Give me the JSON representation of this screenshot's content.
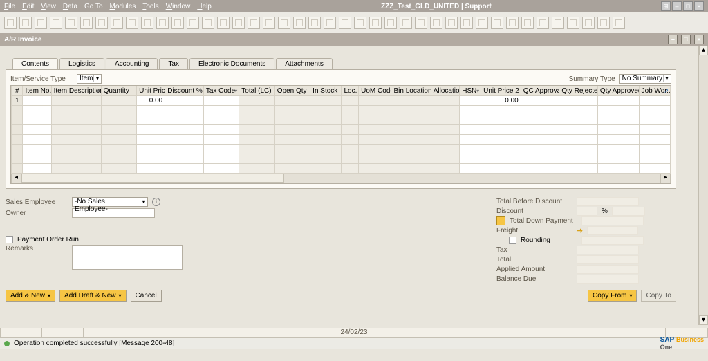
{
  "menubar": {
    "file": "File",
    "edit": "Edit",
    "view": "View",
    "data": "Data",
    "goto": "Go To",
    "modules": "Modules",
    "tools": "Tools",
    "window": "Window",
    "help": "Help"
  },
  "app_title": "ZZZ_Test_GLD_UNITED | Support",
  "window_title": "A/R Invoice",
  "tabs": {
    "contents": "Contents",
    "logistics": "Logistics",
    "accounting": "Accounting",
    "tax": "Tax",
    "edocs": "Electronic Documents",
    "attachments": "Attachments"
  },
  "form": {
    "item_service_label": "Item/Service Type",
    "item_service_value": "Item",
    "summary_type_label": "Summary Type",
    "summary_type_value": "No Summary",
    "columns": {
      "num": "#",
      "itemno": "Item No.",
      "itemdesc": "Item Description",
      "qty": "Quantity",
      "unitprice": "Unit Price",
      "disc": "Discount %",
      "taxcode": "Tax Code",
      "total": "Total (LC)",
      "openqty": "Open Qty",
      "instock": "In Stock",
      "loc": "Loc.",
      "uom": "UoM Code",
      "bin": "Bin Location Allocation",
      "hsn": "HSN",
      "unitprice2": "Unit Price 2",
      "qc": "QC Approval",
      "qtyrej": "Qty Rejected",
      "qtyapp": "Qty Approved",
      "jobwork": "Job Wor..."
    },
    "row1": {
      "idx": "1",
      "unitprice": "0.00",
      "unitprice2": "0.00"
    }
  },
  "lower": {
    "sales_employee_label": "Sales Employee",
    "sales_employee_value": "-No Sales Employee-",
    "owner_label": "Owner",
    "payment_order_run": "Payment Order Run",
    "remarks": "Remarks"
  },
  "totals": {
    "tbd": "Total Before Discount",
    "discount": "Discount",
    "pct": "%",
    "tdp": "Total Down Payment",
    "freight": "Freight",
    "rounding": "Rounding",
    "tax": "Tax",
    "total": "Total",
    "applied": "Applied Amount",
    "balance": "Balance Due"
  },
  "buttons": {
    "add_new": "Add & New",
    "add_draft": "Add Draft & New",
    "cancel": "Cancel",
    "copy_from": "Copy From",
    "copy_to": "Copy To"
  },
  "status": {
    "date": "24/02/23",
    "msg": "Operation completed successfully   [Message 200-48]"
  },
  "branding": {
    "sap": "SAP",
    "business": "Business",
    "one": "One"
  }
}
